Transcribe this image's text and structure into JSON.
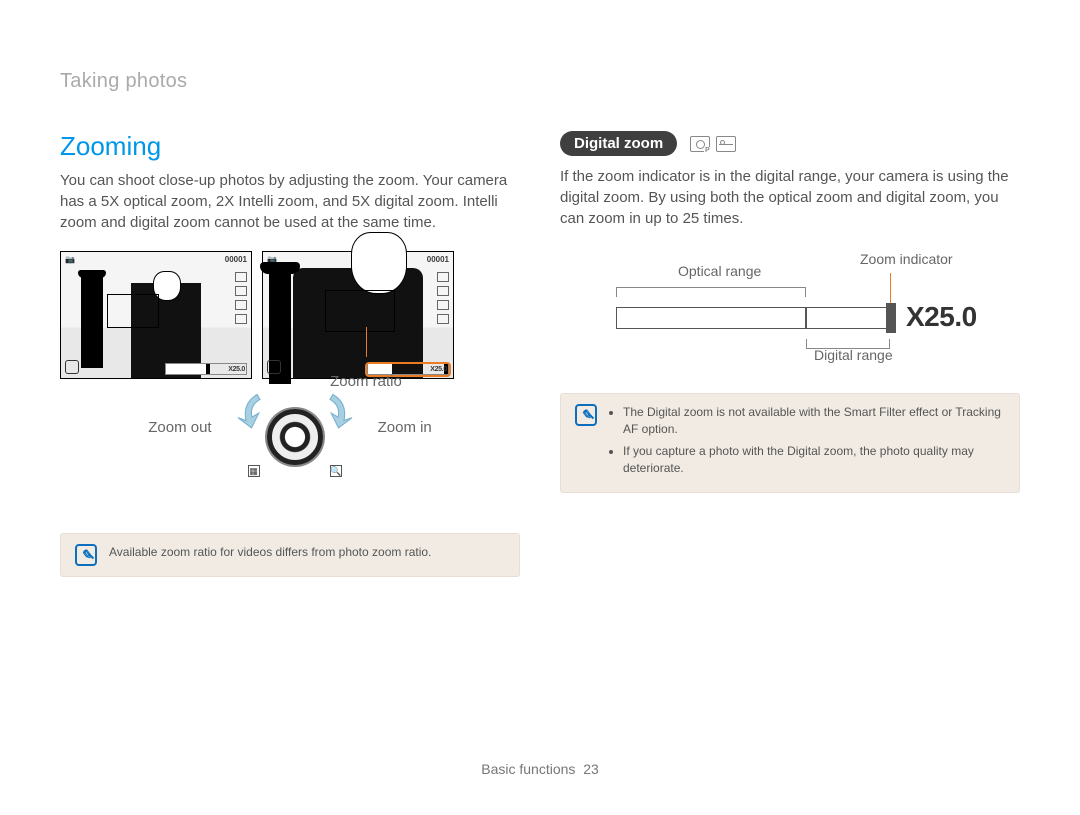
{
  "breadcrumb": "Taking photos",
  "left": {
    "title": "Zooming",
    "body": "You can shoot close-up photos by adjusting the zoom. Your camera has a 5X optical zoom, 2X Intelli zoom, and 5X digital zoom. Intelli zoom and digital zoom cannot be used at the same time.",
    "cam_counter": "00001",
    "zoom_bar_label": "X25.0",
    "zoom_ratio_label": "Zoom ratio",
    "zoom_out": "Zoom out",
    "zoom_in": "Zoom in",
    "note": "Available zoom ratio for videos differs from photo zoom ratio."
  },
  "right": {
    "pill": "Digital zoom",
    "body": "If the zoom indicator is in the digital range, your camera is using the digital zoom. By using both the optical zoom and digital zoom, you can zoom in up to 25 times.",
    "zoom_indicator": "Zoom indicator",
    "optical_range": "Optical range",
    "digital_range": "Digital range",
    "range_value": "X25.0",
    "note1": "The Digital zoom is not available with the Smart Filter effect or Tracking AF option.",
    "note2": "If you capture a photo with the Digital zoom, the photo quality may deteriorate."
  },
  "footer_section": "Basic functions",
  "footer_page": "23"
}
